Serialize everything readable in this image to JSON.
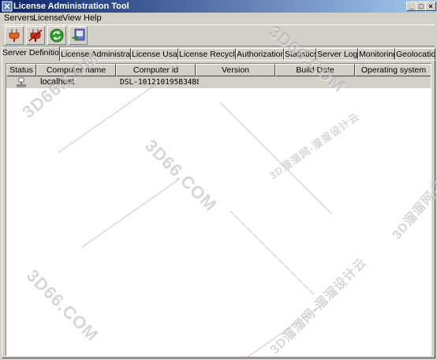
{
  "window": {
    "title": "License Administration Tool",
    "controls": {
      "minimize": "_",
      "maximize": "□",
      "close": "×"
    }
  },
  "menu": [
    "Servers",
    "License",
    "View",
    "Help"
  ],
  "toolbar": {
    "buttons": [
      "plug-connect-icon",
      "plug-disconnect-icon",
      "refresh-icon",
      "export-icon"
    ]
  },
  "tabs": [
    "Server Definitions",
    "License Administration",
    "License Usage",
    "License Recycling",
    "Authorizations",
    "Statistics",
    "Server Logs",
    "Monitoring",
    "Geolocation"
  ],
  "active_tab": "Server Definitions",
  "table": {
    "columns": [
      "Status",
      "Computer name",
      "Computer id",
      "Version",
      "Build Date",
      "Operating system"
    ],
    "rows": [
      {
        "status_icon": "server-icon",
        "computer_name": "localhost",
        "computer_id": "DSL-101210195B34B8",
        "version": "",
        "build_date": "",
        "operating_system": ""
      }
    ]
  },
  "watermarks": [
    "3D66.COM",
    "3D66.COM",
    "3D66.COM",
    "3D66.COM",
    "3D溜溜网-溜溜设计云",
    "3D溜溜网-溜溜设计云",
    "3D溜溜网-溜溜设计云"
  ],
  "colors": {
    "titlebar_start": "#0a246a",
    "titlebar_end": "#a6caf0",
    "face": "#d4d0c8",
    "list_bg": "#ffffff"
  }
}
